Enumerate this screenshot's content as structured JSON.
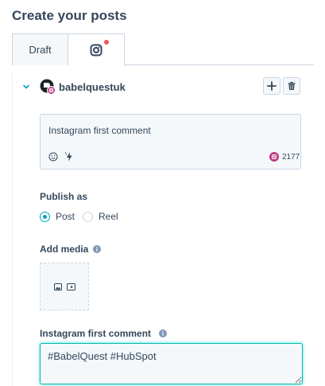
{
  "page": {
    "title": "Create your posts"
  },
  "tabs": [
    {
      "label": "Draft",
      "selected": false
    },
    {
      "label": "",
      "icon": "instagram-icon",
      "selected": true,
      "has_notification_dot": true
    }
  ],
  "account": {
    "name": "babelquestuk",
    "avatar_icon": "instagram-avatar-icon"
  },
  "compose": {
    "text": "Instagram first comment",
    "tools": [
      "emoji-icon",
      "bolt-icon"
    ],
    "char_count": "2177",
    "char_count_icon": "instagram-icon"
  },
  "publish_as": {
    "label": "Publish as",
    "options": [
      {
        "label": "Post",
        "selected": true
      },
      {
        "label": "Reel",
        "selected": false
      }
    ]
  },
  "media": {
    "label": "Add media",
    "icons": [
      "image-icon",
      "video-icon"
    ]
  },
  "first_comment": {
    "label": "Instagram first comment",
    "value": "#BabelQuest #HubSpot"
  },
  "colors": {
    "text": "#33475b",
    "accent": "#00a4bd",
    "focus_border": "#00bda5",
    "notification": "#f2545b",
    "instagram": "#c13584"
  }
}
